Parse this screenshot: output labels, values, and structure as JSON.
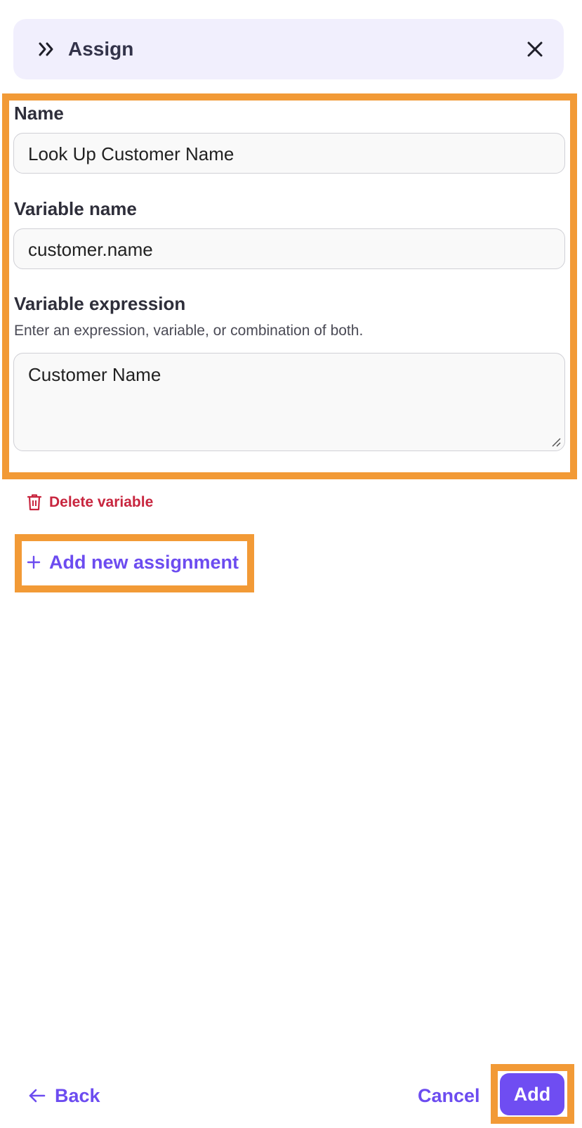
{
  "header": {
    "title": "Assign",
    "icon": "double-chevron-right-icon",
    "close_icon": "close-icon"
  },
  "form": {
    "name_label": "Name",
    "name_value": "Look Up Customer Name",
    "variable_name_label": "Variable name",
    "variable_name_value": "customer.name",
    "variable_expression_label": "Variable expression",
    "variable_expression_help": "Enter an expression, variable, or combination of both.",
    "variable_expression_value": "Customer Name"
  },
  "actions": {
    "delete_variable": "Delete variable",
    "add_new_assignment": "Add new assignment"
  },
  "footer": {
    "back": "Back",
    "cancel": "Cancel",
    "add": "Add"
  },
  "colors": {
    "accent": "#6f4df2",
    "danger": "#c8263f",
    "header_bg": "#f1effd",
    "highlight": "#f29a36"
  }
}
